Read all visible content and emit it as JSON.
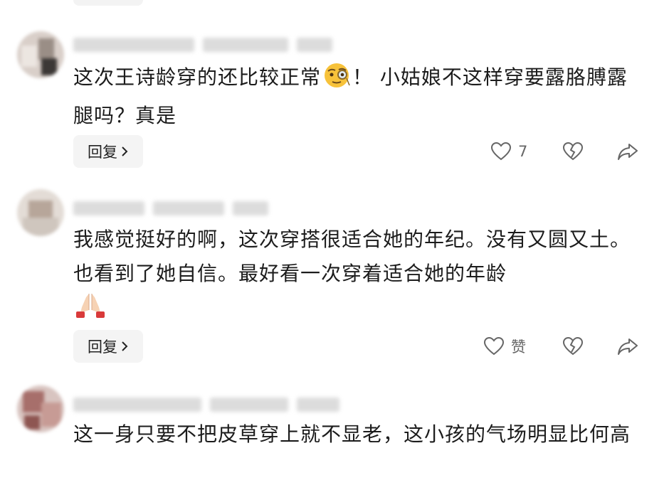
{
  "comments": [
    {
      "text": "这次王诗龄穿的还比较正常",
      "text_after_emoji": "！ 小姑娘不这样穿要露胳膊露腿吗？真是",
      "emoji": "monocle-face-emoji",
      "reply_label": "回复",
      "like_count": "7"
    },
    {
      "text": "我感觉挺好的啊，这次穿搭很适合她的年纪。没有又圆又土。也看到了她自信。最好看一次穿着适合她的年龄",
      "emoji": "folded-hands-emoji",
      "reply_label": "回复",
      "like_label": "赞"
    },
    {
      "text": "这一身只要不把皮草穿上就不显老，这小孩的气场明显比何高"
    }
  ],
  "icons": {
    "like": "heart-outline-icon",
    "dislike": "broken-heart-icon",
    "share": "share-arrow-icon",
    "reply_chevron": "chevron-right-icon"
  },
  "colors": {
    "text": "#1c1c1c",
    "icon": "#666666",
    "reply_bg": "#f4f4f4"
  }
}
